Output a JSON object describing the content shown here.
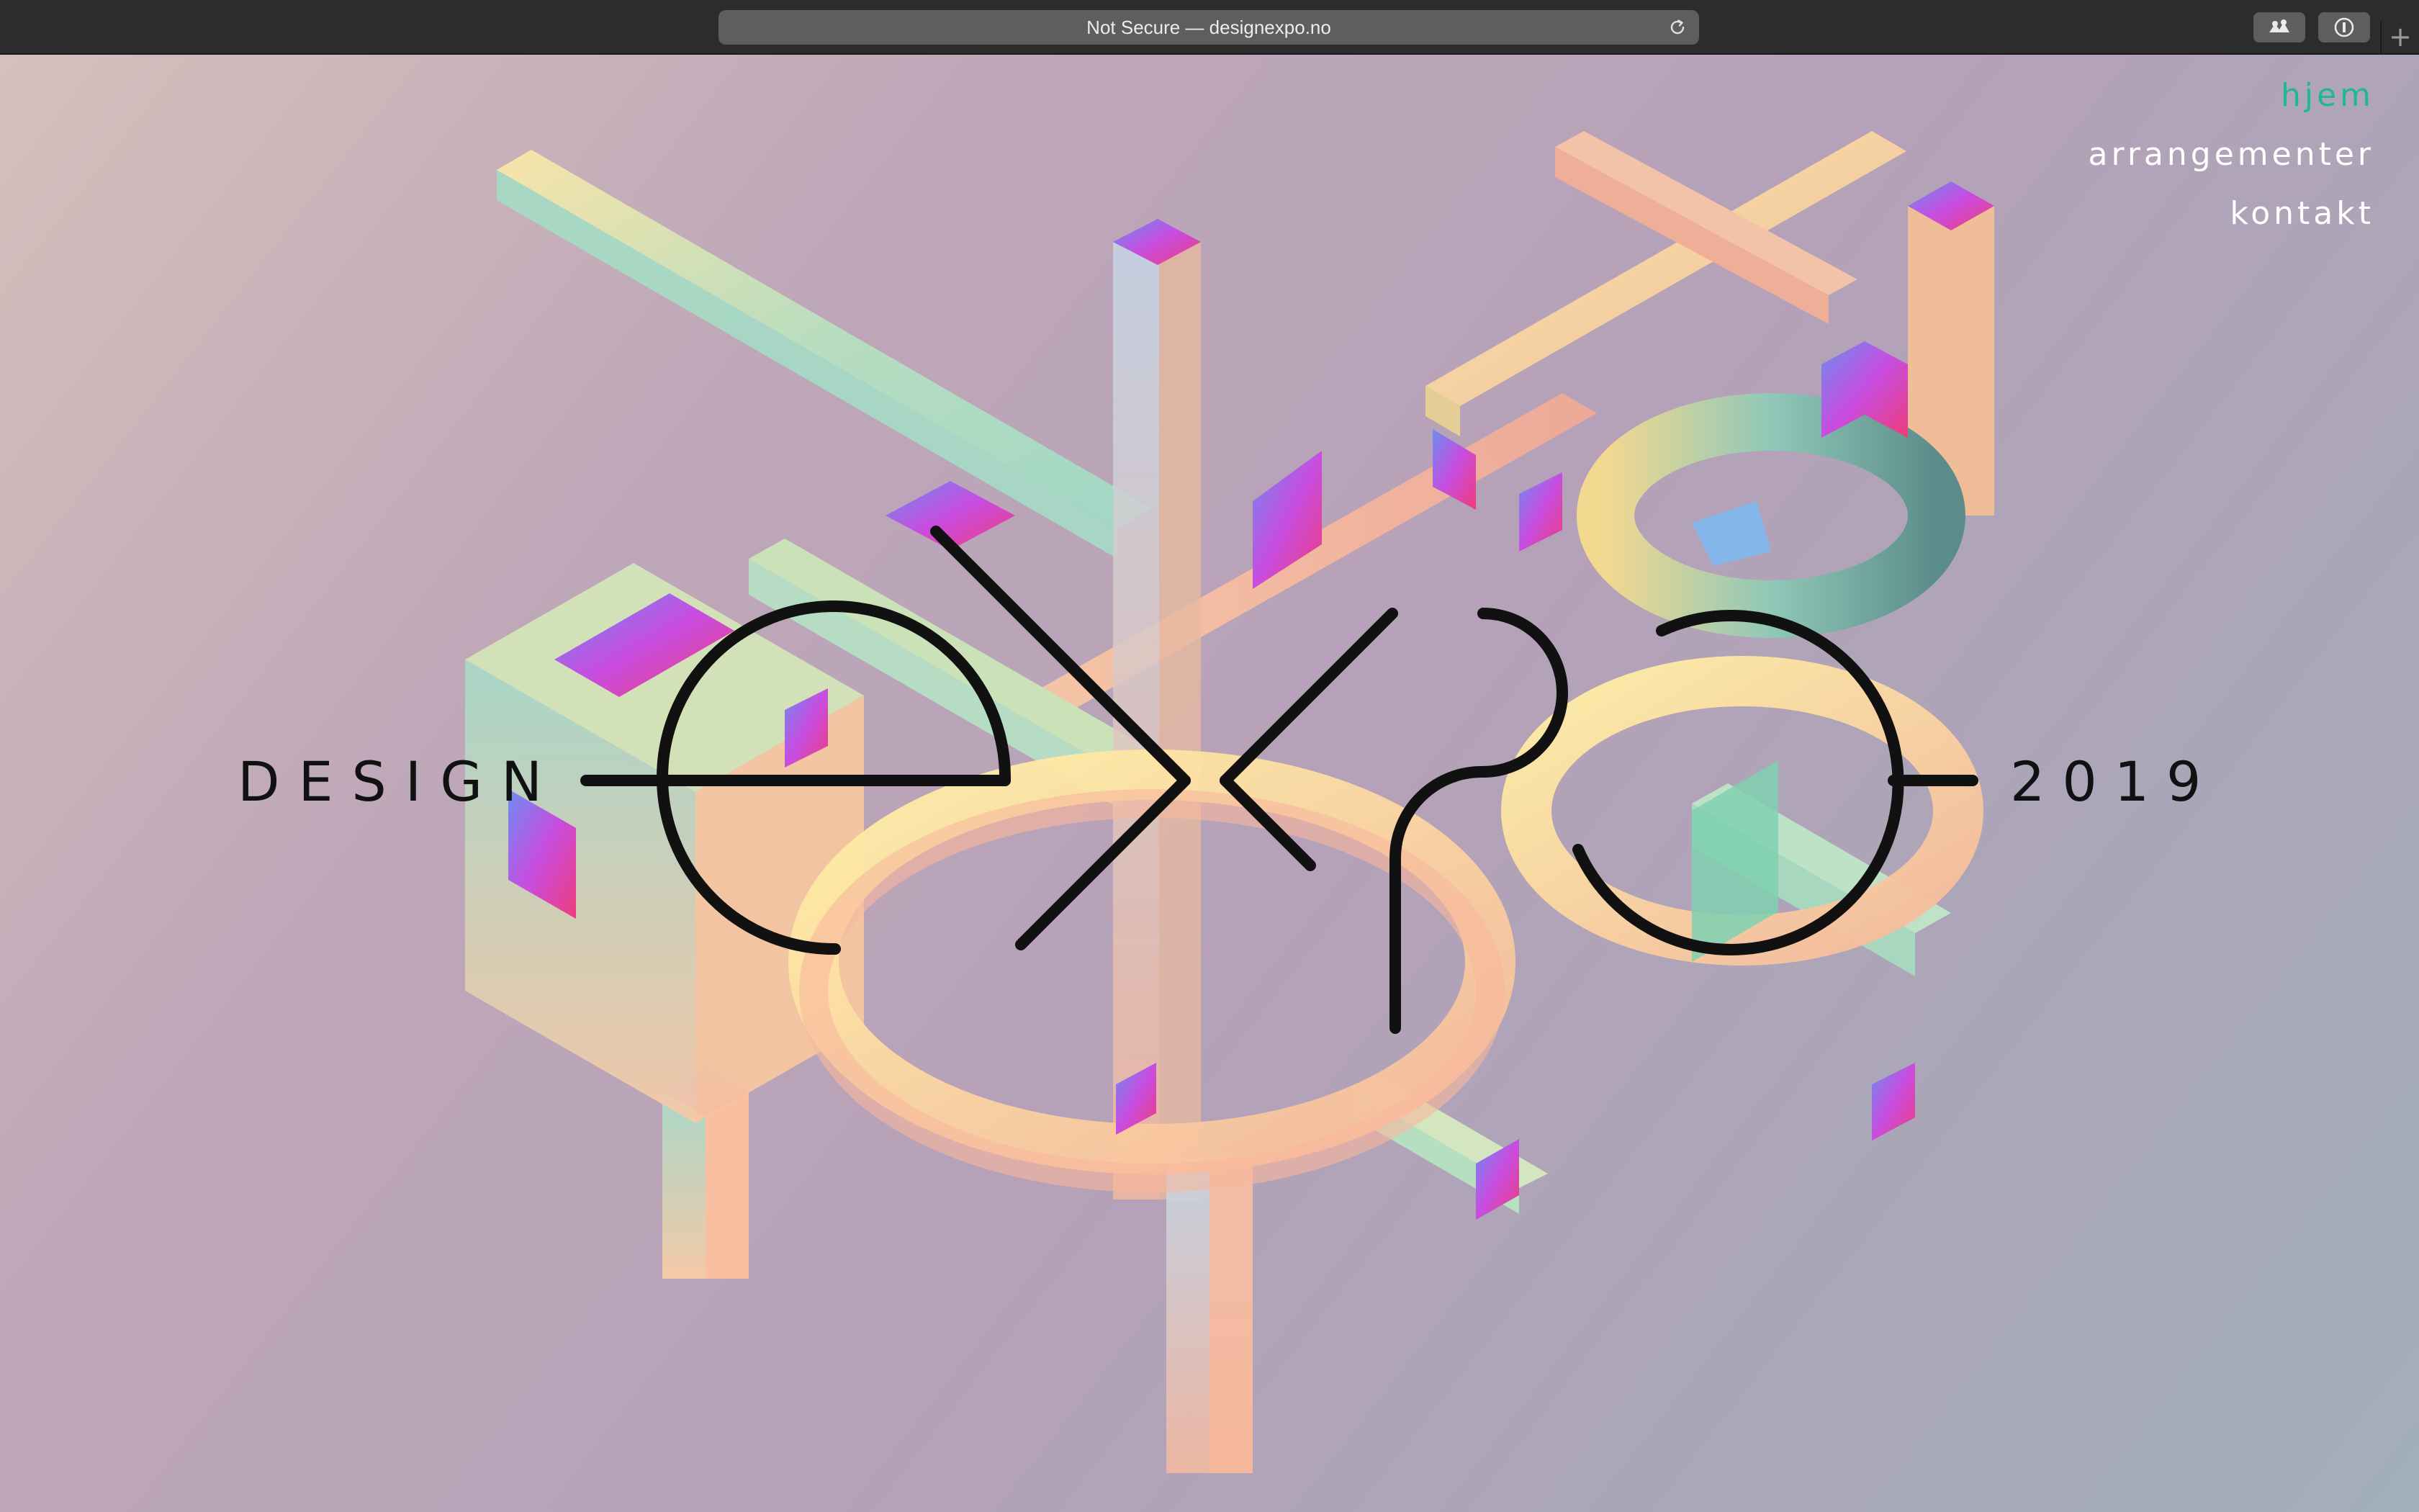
{
  "browser": {
    "address": "Not Secure — designexpo.no",
    "reload_icon": "reload-icon",
    "extensions": [
      "puzzle-icon",
      "password-icon"
    ],
    "new_tab_label": "+"
  },
  "nav": {
    "items": [
      {
        "label": "hjem",
        "active": true
      },
      {
        "label": "arrangementer",
        "active": false
      },
      {
        "label": "kontakt",
        "active": false
      }
    ],
    "active_color": "#1fb890"
  },
  "hero": {
    "left_word": "DESIGN",
    "right_word": "2019",
    "logo_name": "expo-logo"
  },
  "colors": {
    "background_start": "#d4c0bc",
    "background_end": "#a2aebc",
    "logo_stroke": "#111111"
  }
}
